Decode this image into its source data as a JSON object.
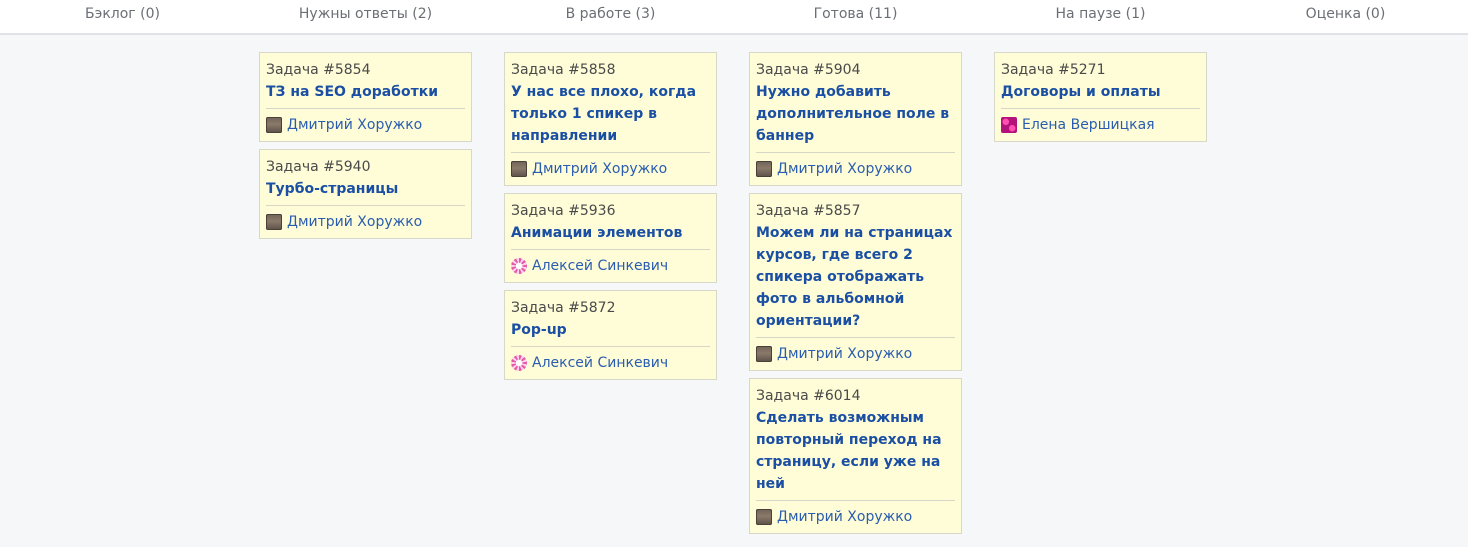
{
  "columns": [
    {
      "title": "Бэклог (0)",
      "cards": []
    },
    {
      "title": "Нужны ответы (2)",
      "cards": [
        {
          "number": "Задача #5854",
          "title": "ТЗ на SEO доработки",
          "assignee": "Дмитрий Хоружко",
          "avatar": "photo"
        },
        {
          "number": "Задача #5940",
          "title": "Турбо-страницы",
          "assignee": "Дмитрий Хоружко",
          "avatar": "photo"
        }
      ]
    },
    {
      "title": "В работе (3)",
      "cards": [
        {
          "number": "Задача #5858",
          "title": "У нас все плохо, когда только 1 спикер в направлении",
          "assignee": "Дмитрий Хоружко",
          "avatar": "photo"
        },
        {
          "number": "Задача #5936",
          "title": "Анимации элементов",
          "assignee": "Алексей Синкевич",
          "avatar": "pattern-pink"
        },
        {
          "number": "Задача #5872",
          "title": "Pop-up",
          "assignee": "Алексей Синкевич",
          "avatar": "pattern-pink"
        }
      ]
    },
    {
      "title": "Готова (11)",
      "cards": [
        {
          "number": "Задача #5904",
          "title": "Нужно добавить дополнительное поле в баннер",
          "assignee": "Дмитрий Хоружко",
          "avatar": "photo"
        },
        {
          "number": "Задача #5857",
          "title": "Можем ли на страницах курсов, где всего 2 спикера отображать фото в альбомной ориентации?",
          "assignee": "Дмитрий Хоружко",
          "avatar": "photo"
        },
        {
          "number": "Задача #6014",
          "title": "Сделать возможным повторный переход на страницу, если уже на ней",
          "assignee": "Дмитрий Хоружко",
          "avatar": "photo"
        }
      ]
    },
    {
      "title": "На паузе (1)",
      "cards": [
        {
          "number": "Задача #5271",
          "title": "Договоры и оплаты",
          "assignee": "Елена Вершицкая",
          "avatar": "pattern-magenta"
        }
      ]
    },
    {
      "title": "Оценка (0)",
      "cards": []
    }
  ]
}
